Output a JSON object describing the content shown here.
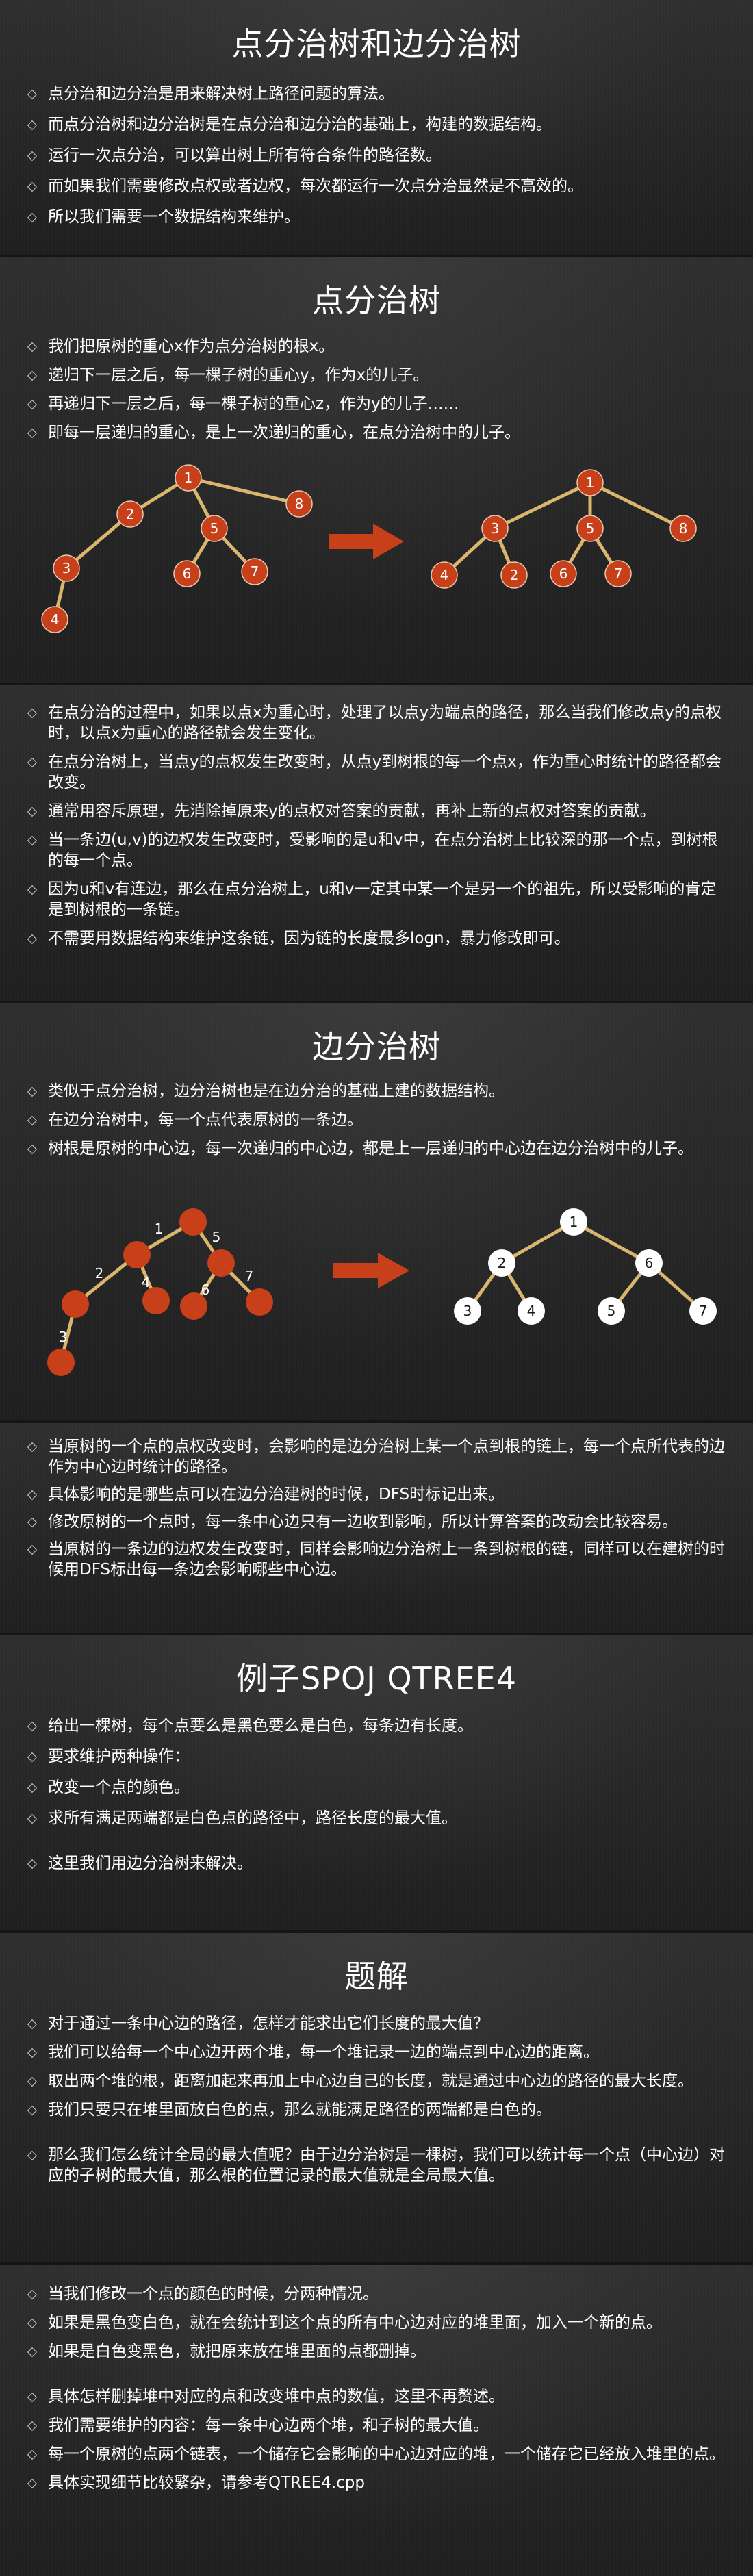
{
  "slide1": {
    "title": "点分治树和边分治树",
    "bullets": [
      "点分治和边分治是用来解决树上路径问题的算法。",
      "而点分治树和边分治树是在点分治和边分治的基础上，构建的数据结构。",
      "运行一次点分治，可以算出树上所有符合条件的路径数。",
      "而如果我们需要修改点权或者边权，每次都运行一次点分治显然是不高效的。",
      "所以我们需要一个数据结构来维护。"
    ]
  },
  "slide2": {
    "title": "点分治树",
    "bullets": [
      "我们把原树的重心x作为点分治树的根x。",
      "递归下一层之后，每一棵子树的重心y，作为x的儿子。",
      "再递归下一层之后，每一棵子树的重心z，作为y的儿子……",
      "即每一层递归的重心，是上一次递归的重心，在点分治树中的儿子。"
    ],
    "left_tree": {
      "n1": "1",
      "n2": "2",
      "n3": "3",
      "n4": "4",
      "n5": "5",
      "n6": "6",
      "n7": "7",
      "n8": "8"
    },
    "right_tree": {
      "n1": "1",
      "n2": "2",
      "n3": "3",
      "n4": "4",
      "n5": "5",
      "n6": "6",
      "n7": "7",
      "n8": "8"
    }
  },
  "slide3": {
    "bullets": [
      "在点分治的过程中，如果以点x为重心时，处理了以点y为端点的路径，那么当我们修改点y的点权时，以点x为重心的路径就会发生变化。",
      "在点分治树上，当点y的点权发生改变时，从点y到树根的每一个点x，作为重心时统计的路径都会改变。",
      "通常用容斥原理，先消除掉原来y的点权对答案的贡献，再补上新的点权对答案的贡献。",
      "当一条边(u,v)的边权发生改变时，受影响的是u和v中，在点分治树上比较深的那一个点，到树根的每一个点。",
      "因为u和v有连边，那么在点分治树上，u和v一定其中某一个是另一个的祖先，所以受影响的肯定是到树根的一条链。",
      "不需要用数据结构来维护这条链，因为链的长度最多logn，暴力修改即可。"
    ]
  },
  "slide4": {
    "title": "边分治树",
    "bullets": [
      "类似于点分治树，边分治树也是在边分治的基础上建的数据结构。",
      "在边分治树中，每一个点代表原树的一条边。",
      "树根是原树的中心边，每一次递归的中心边，都是上一层递归的中心边在边分治树中的儿子。"
    ],
    "left_edges": {
      "e1": "1",
      "e2": "2",
      "e3": "3",
      "e4": "4",
      "e5": "5",
      "e6": "6",
      "e7": "7"
    },
    "right_tree": {
      "n1": "1",
      "n2": "2",
      "n3": "3",
      "n4": "4",
      "n5": "5",
      "n6": "6",
      "n7": "7"
    }
  },
  "slide5": {
    "bullets": [
      "当原树的一个点的点权改变时，会影响的是边分治树上某一个点到根的链上，每一个点所代表的边作为中心边时统计的路径。",
      "具体影响的是哪些点可以在边分治建树的时候，DFS时标记出来。",
      "修改原树的一个点时，每一条中心边只有一边收到影响，所以计算答案的改动会比较容易。",
      "当原树的一条边的边权发生改变时，同样会影响边分治树上一条到树根的链，同样可以在建树的时候用DFS标出每一条边会影响哪些中心边。"
    ]
  },
  "slide6": {
    "title": "例子SPOJ QTREE4",
    "bullets": [
      "给出一棵树，每个点要么是黑色要么是白色，每条边有长度。",
      "要求维护两种操作：",
      "改变一个点的颜色。",
      "求所有满足两端都是白色点的路径中，路径长度的最大值。",
      "这里我们用边分治树来解决。"
    ]
  },
  "slide7": {
    "title": "题解",
    "bullets": [
      "对于通过一条中心边的路径，怎样才能求出它们长度的最大值？",
      "我们可以给每一个中心边开两个堆，每一个堆记录一边的端点到中心边的距离。",
      "取出两个堆的根，距离加起来再加上中心边自己的长度，就是通过中心边的路径的最大长度。",
      "我们只要只在堆里面放白色的点，那么就能满足路径的两端都是白色的。",
      "那么我们怎么统计全局的最大值呢？由于边分治树是一棵树，我们可以统计每一个点（中心边）对应的子树的最大值，那么根的位置记录的最大值就是全局最大值。"
    ]
  },
  "slide8": {
    "bullets": [
      "当我们修改一个点的颜色的时候，分两种情况。",
      "如果是黑色变白色，就在会统计到这个点的所有中心边对应的堆里面，加入一个新的点。",
      "如果是白色变黑色，就把原来放在堆里面的点都删掉。",
      "具体怎样删掉堆中对应的点和改变堆中点的数值，这里不再赘述。",
      "我们需要维护的内容：每一条中心边两个堆，和子树的最大值。",
      "每一个原树的点两个链表，一个储存它会影响的中心边对应的堆，一个储存它已经放入堆里的点。",
      "具体实现细节比较繁杂，请参考QTREE4.cpp"
    ]
  },
  "colors": {
    "node_red": "#c8401a",
    "edge_tan": "#d9b56e",
    "arrow_red": "#c8401a",
    "node_white": "#ffffff"
  }
}
